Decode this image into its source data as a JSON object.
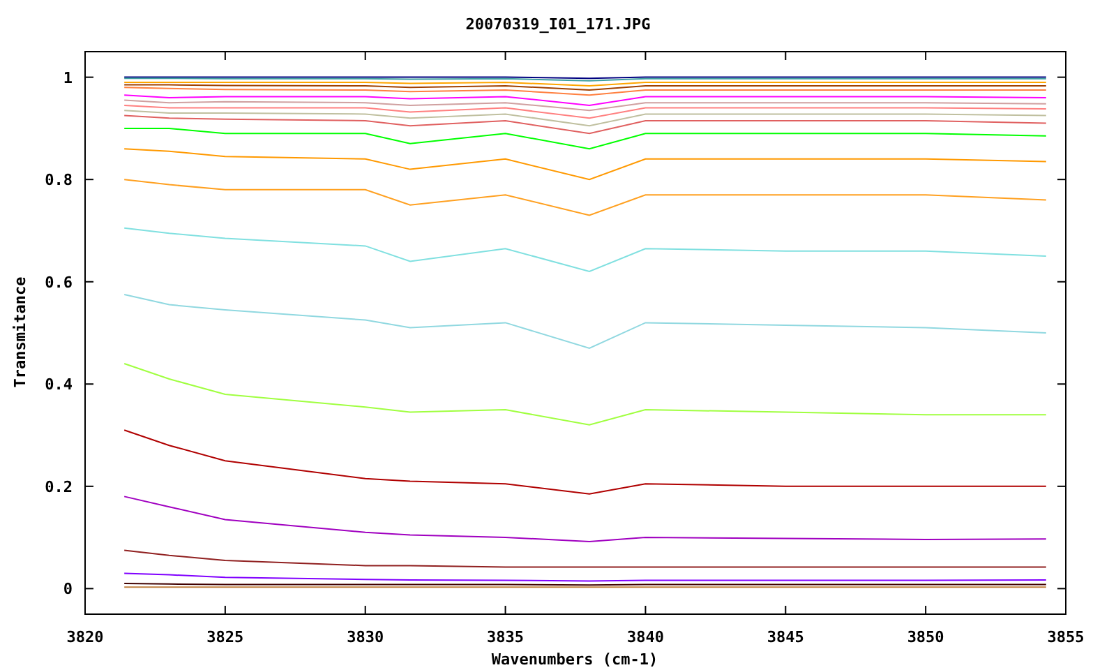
{
  "chart_data": {
    "type": "line",
    "title": "20070319_I01_171.JPG",
    "xlabel": "Wavenumbers (cm-1)",
    "ylabel": "Transmitance",
    "xlim": [
      3820,
      3855
    ],
    "ylim": [
      -0.05,
      1.05
    ],
    "xticks": [
      3820,
      3825,
      3830,
      3835,
      3840,
      3845,
      3850,
      3855
    ],
    "yticks": [
      0,
      0.2,
      0.4,
      0.6,
      0.8,
      1
    ],
    "x": [
      3821.4,
      3823,
      3825,
      3830,
      3831.6,
      3835,
      3838,
      3840,
      3845,
      3850,
      3854.3
    ],
    "series": [
      {
        "color": "#000080",
        "values": [
          1.0,
          1.0,
          1.0,
          1.0,
          1.0,
          1.0,
          0.998,
          1.0,
          1.0,
          1.0,
          1.0
        ]
      },
      {
        "color": "#40a0a0",
        "values": [
          0.998,
          0.998,
          0.997,
          0.997,
          0.996,
          0.997,
          0.993,
          0.997,
          0.997,
          0.997,
          0.997
        ]
      },
      {
        "color": "#ffa500",
        "values": [
          0.99,
          0.99,
          0.99,
          0.99,
          0.988,
          0.99,
          0.983,
          0.99,
          0.99,
          0.99,
          0.99
        ]
      },
      {
        "color": "#a04000",
        "values": [
          0.985,
          0.985,
          0.984,
          0.983,
          0.98,
          0.983,
          0.975,
          0.983,
          0.983,
          0.983,
          0.983
        ]
      },
      {
        "color": "#ff8040",
        "values": [
          0.98,
          0.978,
          0.976,
          0.975,
          0.972,
          0.975,
          0.965,
          0.975,
          0.975,
          0.975,
          0.975
        ]
      },
      {
        "color": "#ff00ff",
        "values": [
          0.965,
          0.96,
          0.962,
          0.962,
          0.958,
          0.962,
          0.945,
          0.962,
          0.962,
          0.962,
          0.96
        ]
      },
      {
        "color": "#d0a0a0",
        "values": [
          0.955,
          0.95,
          0.952,
          0.95,
          0.945,
          0.95,
          0.935,
          0.95,
          0.95,
          0.95,
          0.948
        ]
      },
      {
        "color": "#ff8080",
        "values": [
          0.945,
          0.94,
          0.94,
          0.94,
          0.932,
          0.94,
          0.92,
          0.94,
          0.94,
          0.94,
          0.938
        ]
      },
      {
        "color": "#c0c0a0",
        "values": [
          0.935,
          0.93,
          0.93,
          0.928,
          0.92,
          0.928,
          0.905,
          0.928,
          0.928,
          0.928,
          0.925
        ]
      },
      {
        "color": "#e06060",
        "values": [
          0.925,
          0.92,
          0.918,
          0.915,
          0.905,
          0.915,
          0.89,
          0.915,
          0.915,
          0.915,
          0.91
        ]
      },
      {
        "color": "#00ff00",
        "values": [
          0.9,
          0.9,
          0.89,
          0.89,
          0.87,
          0.89,
          0.86,
          0.89,
          0.89,
          0.89,
          0.885
        ]
      },
      {
        "color": "#ff9900",
        "values": [
          0.86,
          0.855,
          0.845,
          0.84,
          0.82,
          0.84,
          0.8,
          0.84,
          0.84,
          0.84,
          0.835
        ]
      },
      {
        "color": "#ffa020",
        "values": [
          0.8,
          0.79,
          0.78,
          0.78,
          0.75,
          0.77,
          0.73,
          0.77,
          0.77,
          0.77,
          0.76
        ]
      },
      {
        "color": "#80e0e0",
        "values": [
          0.705,
          0.695,
          0.685,
          0.67,
          0.64,
          0.665,
          0.62,
          0.665,
          0.66,
          0.66,
          0.65
        ]
      },
      {
        "color": "#90d8e0",
        "values": [
          0.575,
          0.555,
          0.545,
          0.525,
          0.51,
          0.52,
          0.47,
          0.52,
          0.515,
          0.51,
          0.5
        ]
      },
      {
        "color": "#a0ff40",
        "values": [
          0.44,
          0.41,
          0.38,
          0.355,
          0.345,
          0.35,
          0.32,
          0.35,
          0.345,
          0.34,
          0.34
        ]
      },
      {
        "color": "#b00000",
        "values": [
          0.31,
          0.28,
          0.25,
          0.215,
          0.21,
          0.205,
          0.185,
          0.205,
          0.2,
          0.2,
          0.2
        ]
      },
      {
        "color": "#a000c0",
        "values": [
          0.18,
          0.16,
          0.135,
          0.11,
          0.105,
          0.1,
          0.092,
          0.1,
          0.098,
          0.096,
          0.097
        ]
      },
      {
        "color": "#902020",
        "values": [
          0.075,
          0.065,
          0.055,
          0.045,
          0.045,
          0.042,
          0.042,
          0.042,
          0.042,
          0.042,
          0.042
        ]
      },
      {
        "color": "#8000ff",
        "values": [
          0.03,
          0.027,
          0.022,
          0.018,
          0.017,
          0.016,
          0.015,
          0.016,
          0.016,
          0.016,
          0.017
        ]
      },
      {
        "color": "#400000",
        "values": [
          0.01,
          0.009,
          0.008,
          0.008,
          0.008,
          0.008,
          0.007,
          0.008,
          0.008,
          0.008,
          0.008
        ]
      },
      {
        "color": "#c08040",
        "values": [
          0.003,
          0.003,
          0.003,
          0.003,
          0.003,
          0.003,
          0.003,
          0.003,
          0.003,
          0.003,
          0.003
        ]
      }
    ]
  }
}
